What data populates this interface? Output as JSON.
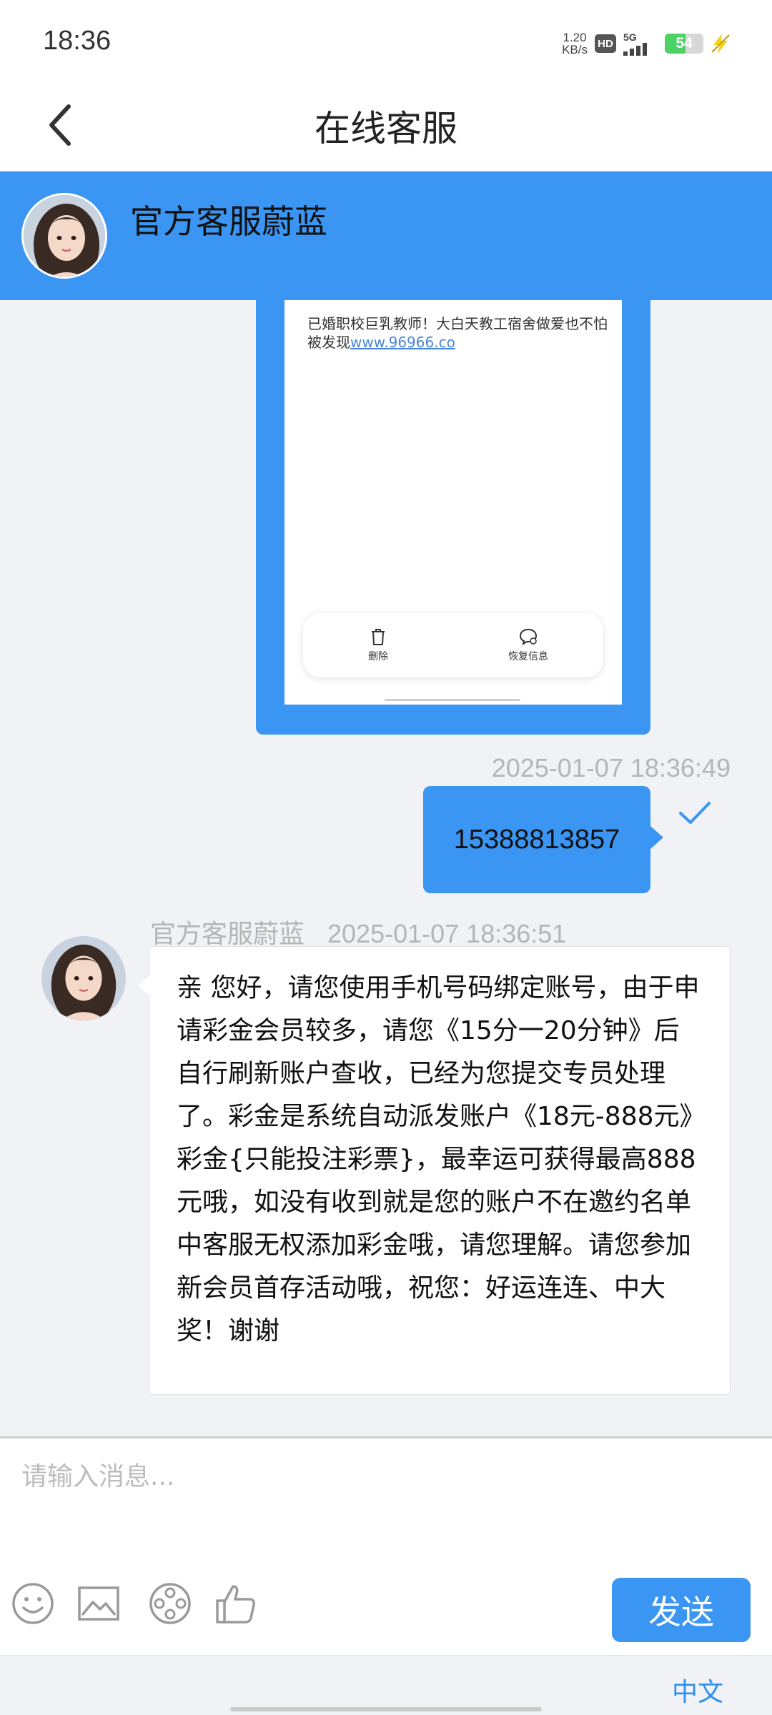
{
  "status_bar": {
    "time": "18:36",
    "net_speed_value": "1.20",
    "net_speed_unit": "KB/s",
    "hd_label": "HD",
    "network_type": "5G",
    "battery_percent": "54",
    "battery_level": 0.54,
    "icons": [
      "hd-icon",
      "signal-icon",
      "battery-icon",
      "charging-icon"
    ]
  },
  "nav": {
    "title": "在线客服",
    "back_icon": "chevron-left-icon"
  },
  "agent": {
    "name": "官方客服蔚蓝"
  },
  "messages": {
    "image_message": {
      "text_before_link": "已婚职校巨乳教师！大白天教工宿舍做爱也不怕被发现",
      "link_text": "www.96966.co",
      "actions": [
        {
          "label": "删除",
          "icon": "trash-icon"
        },
        {
          "label": "恢复信息",
          "icon": "restore-message-icon"
        }
      ]
    },
    "outgoing": {
      "timestamp": "2025-01-07 18:36:49",
      "text": "15388813857",
      "status_icon": "check-icon"
    },
    "incoming": {
      "sender": "官方客服蔚蓝",
      "timestamp": "2025-01-07 18:36:51",
      "text": "亲 您好，请您使用手机号码绑定账号，由于申请彩金会员较多，请您《15分一20分钟》后自行刷新账户查收，已经为您提交专员处理了。彩金是系统自动派发账户《18元-888元》彩金{只能投注彩票}，最幸运可获得最高888元哦，如没有收到就是您的账户不在邀约名单中客服无权添加彩金哦，请您理解。请您参加新会员首存活动哦，祝您：好运连连、中大奖！谢谢"
    }
  },
  "composer": {
    "placeholder": "请输入消息...",
    "value": "",
    "tools": [
      "emoji-icon",
      "image-icon",
      "film-reel-icon",
      "thumbs-up-icon"
    ],
    "send_label": "发送"
  },
  "footer": {
    "language": "中文"
  },
  "colors": {
    "accent": "#3b95f3",
    "background": "#f1f2f6",
    "link": "#2d8ff0",
    "timestamp": "#b5b5b5"
  }
}
